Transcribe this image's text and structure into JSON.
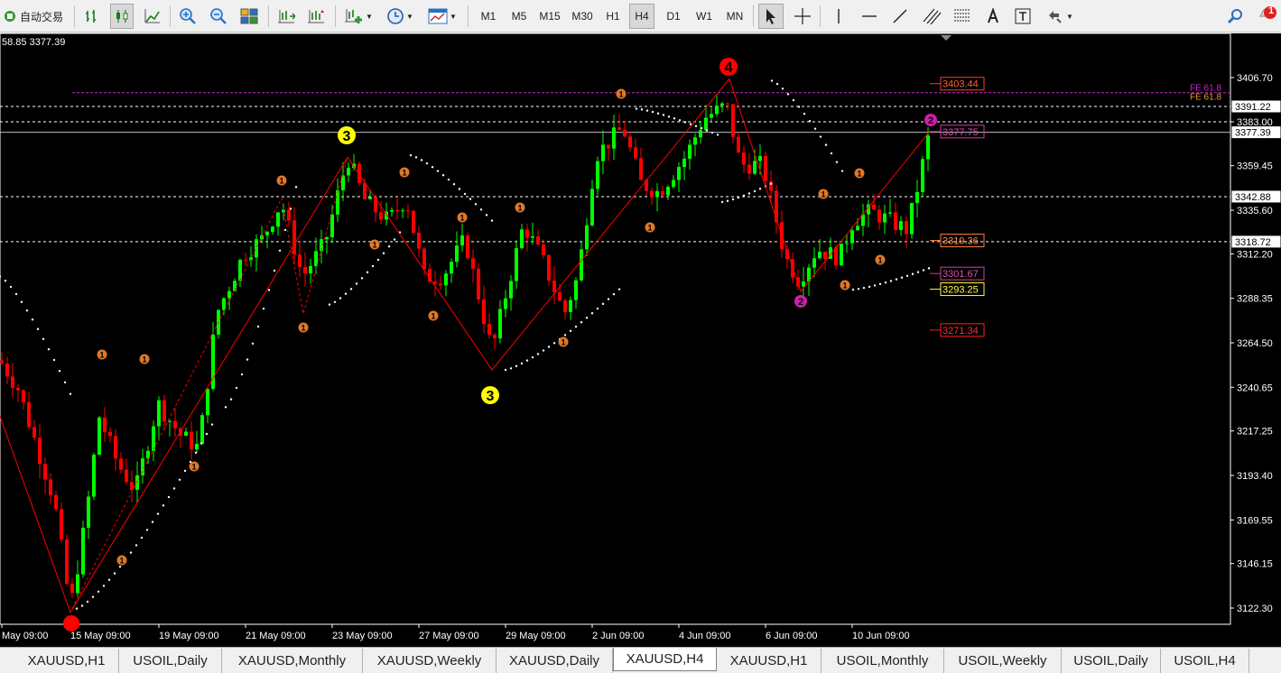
{
  "toolbar": {
    "autotrade_label": "自动交易",
    "timeframes": [
      "M1",
      "M5",
      "M15",
      "M30",
      "H1",
      "H4",
      "D1",
      "W1",
      "MN"
    ],
    "active_timeframe": "H4",
    "notification_count": "1"
  },
  "chart": {
    "ohlc_text": "58.85 3377.39",
    "y_ticks": [
      "3406.70",
      "3383.00",
      "3359.45",
      "3335.60",
      "3312.20",
      "3288.35",
      "3264.50",
      "3240.65",
      "3217.25",
      "3193.40",
      "3169.55",
      "3146.15",
      "3122.30"
    ],
    "x_ticks": [
      "May 09:00",
      "15 May 09:00",
      "19 May 09:00",
      "21 May 09:00",
      "23 May 09:00",
      "27 May 09:00",
      "29 May 09:00",
      "2 Jun 09:00",
      "4 Jun 09:00",
      "6 Jun 09:00",
      "10 Jun 09:00"
    ],
    "price_labels": [
      "3391.22",
      "3377.39",
      "3342.88",
      "3318.72"
    ],
    "level_boxes": [
      "3403.44",
      "3377.75",
      "3319.36",
      "3301.67",
      "3293.25",
      "3271.34"
    ],
    "fe_labels": [
      "FE 61.8",
      "FE 61.8"
    ],
    "wave_labels": [
      "4",
      "3",
      "3",
      "2",
      "2"
    ],
    "sub_wave_label": "1",
    "colors": {
      "bull": "#00ff00",
      "bear": "#ff0000",
      "background": "#000000",
      "wave_red": "#ff0000",
      "wave_yellow": "#ffff00",
      "wave_magenta": "#cc1faa",
      "sub_wave": "#e07828"
    }
  },
  "tabs": [
    "XAUUSD,H1",
    "USOIL,Daily",
    "XAUUSD,Monthly",
    "XAUUSD,Weekly",
    "XAUUSD,Daily",
    "XAUUSD,H4",
    "XAUUSD,H1",
    "USOIL,Monthly",
    "USOIL,Weekly",
    "USOIL,Daily",
    "USOIL,H4"
  ],
  "active_tab": "XAUUSD,H4"
}
